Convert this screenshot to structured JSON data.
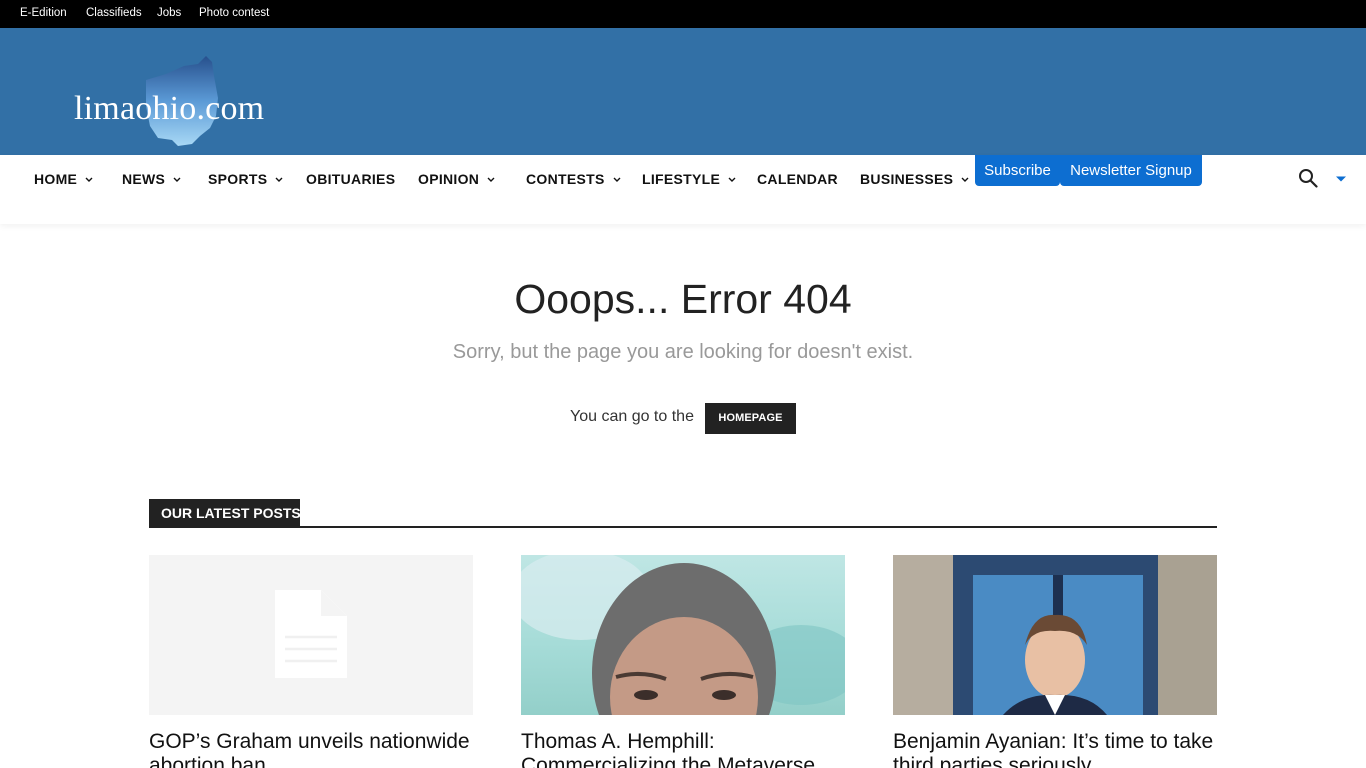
{
  "topbar": {
    "links": [
      "E-Edition",
      "Classifieds",
      "Jobs",
      "Photo contest"
    ]
  },
  "header": {
    "logo_text": "limaohio.com"
  },
  "nav": {
    "items": [
      {
        "label": "HOME",
        "has_dropdown": true
      },
      {
        "label": "NEWS",
        "has_dropdown": true
      },
      {
        "label": "SPORTS",
        "has_dropdown": true
      },
      {
        "label": "OBITUARIES",
        "has_dropdown": false
      },
      {
        "label": "OPINION",
        "has_dropdown": true
      },
      {
        "label": "CONTESTS",
        "has_dropdown": true
      },
      {
        "label": "LIFESTYLE",
        "has_dropdown": true
      },
      {
        "label": "CALENDAR",
        "has_dropdown": false
      },
      {
        "label": "BUSINESSES",
        "has_dropdown": true
      }
    ],
    "subscribe_label": "Subscribe",
    "newsletter_label": "Newsletter Signup",
    "search_icon": "search-icon",
    "menu_icon": "caret-down-icon"
  },
  "error": {
    "title": "Ooops... Error 404",
    "subtitle": "Sorry, but the page you are looking for doesn't exist.",
    "goto_text": "You can go to the",
    "homepage_label": "HOMEPAGE"
  },
  "latest": {
    "section_title": "OUR LATEST POSTS",
    "posts": [
      {
        "title": "GOP’s Graham unveils nationwide abortion ban",
        "image": "placeholder-document-icon"
      },
      {
        "title": "Thomas A. Hemphill: Commercializing the Metaverse",
        "image": "portrait-illustration"
      },
      {
        "title": "Benjamin Ayanian: It’s time to take third parties seriously",
        "image": "portrait-photo"
      }
    ]
  },
  "colors": {
    "topbar": "#000000",
    "header": "#3270a6",
    "accent_button": "#0d6ed1",
    "dark": "#222222"
  }
}
